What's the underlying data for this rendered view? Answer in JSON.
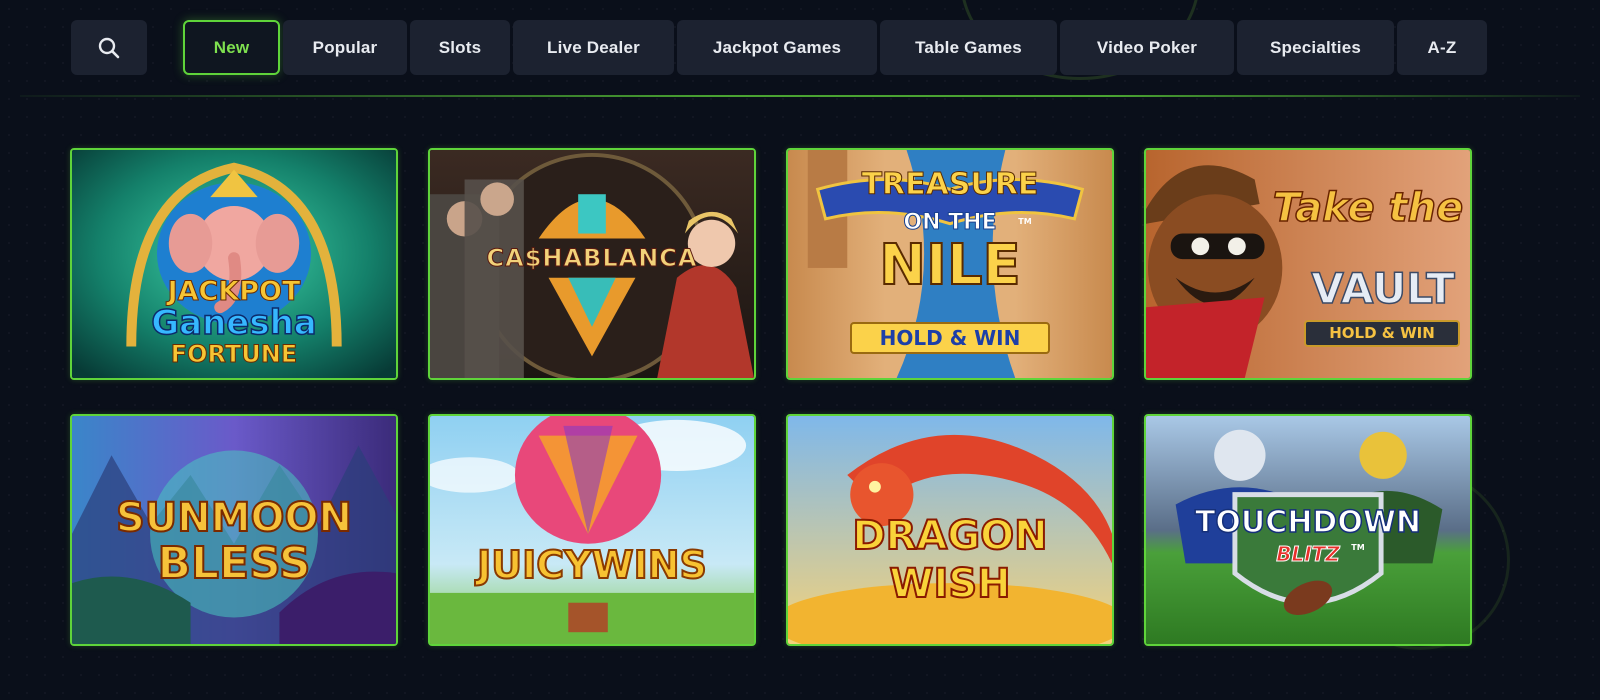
{
  "search": {
    "icon": "search-icon"
  },
  "tabs": [
    {
      "label": "New",
      "active": true
    },
    {
      "label": "Popular",
      "active": false
    },
    {
      "label": "Slots",
      "active": false
    },
    {
      "label": "Live Dealer",
      "active": false
    },
    {
      "label": "Jackpot Games",
      "active": false
    },
    {
      "label": "Table Games",
      "active": false
    },
    {
      "label": "Video Poker",
      "active": false
    },
    {
      "label": "Specialties",
      "active": false
    },
    {
      "label": "A-Z",
      "active": false
    }
  ],
  "games": [
    {
      "title_line1": "JACKPOT",
      "title_line2": "Ganesha",
      "title_line3": "FORTUNE"
    },
    {
      "title_line1": "CA$HABLANCA"
    },
    {
      "title_line1": "TREASURE",
      "title_line2": "ON THE",
      "title_line3": "NILE",
      "badge": "HOLD & WIN",
      "tm": "TM"
    },
    {
      "title_line1": "Take the",
      "title_line2": "VAULT",
      "badge": "HOLD & WIN"
    },
    {
      "title_line1": "SUNMOON",
      "title_line2": "BLESS"
    },
    {
      "title_line1": "JUICYWINS"
    },
    {
      "title_line1": "DRAGON",
      "title_line2": "WISH"
    },
    {
      "title_line1": "TOUCHDOWN",
      "title_line2": "BLITZ",
      "tm": "TM"
    }
  ],
  "colors": {
    "accent": "#5fd43a",
    "tab_bg": "#1c2230",
    "page_bg": "#0a0f1a"
  }
}
